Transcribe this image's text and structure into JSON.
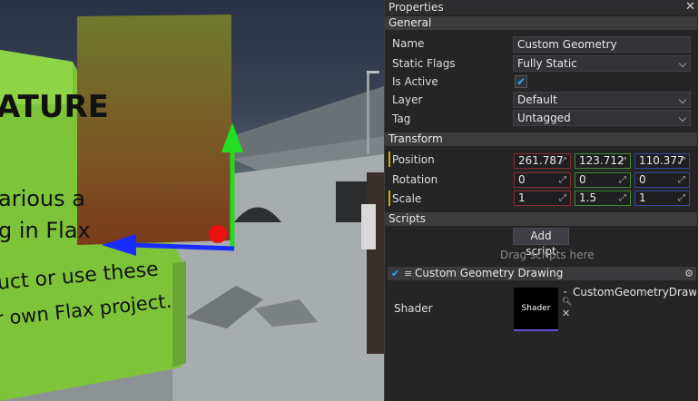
{
  "viewport": {
    "sign_texts": [
      "ATURE",
      "arious a",
      "g in Flax",
      "uct or use these",
      "r own Flax project."
    ]
  },
  "panel": {
    "title": "Properties",
    "close_icon": "close-icon",
    "sections": {
      "general": "General",
      "transform": "Transform",
      "scripts": "Scripts"
    },
    "general": {
      "name_label": "Name",
      "name_value": "Custom Geometry",
      "static_flags_label": "Static Flags",
      "static_flags_value": "Fully Static",
      "is_active_label": "Is Active",
      "is_active_checked": true,
      "layer_label": "Layer",
      "layer_value": "Default",
      "tag_label": "Tag",
      "tag_value": "Untagged"
    },
    "transform": {
      "position_label": "Position",
      "position": [
        "261.787",
        "123.712",
        "110.377"
      ],
      "rotation_label": "Rotation",
      "rotation": [
        "0",
        "0",
        "0"
      ],
      "scale_label": "Scale",
      "scale": [
        "1",
        "1.5",
        "1"
      ]
    },
    "scripts": {
      "add_script": "Add script",
      "drag_hint": "Drag scripts here",
      "script_name": "Custom Geometry Drawing",
      "shader_label": "Shader",
      "shader_thumb": "Shader",
      "shader_value": "CustomGeometryDrawin"
    },
    "colors": {
      "x_axis": "#8a2b30",
      "y_axis": "#3f8a3a",
      "z_axis": "#3845a0",
      "check": "#2aa8ff"
    }
  }
}
